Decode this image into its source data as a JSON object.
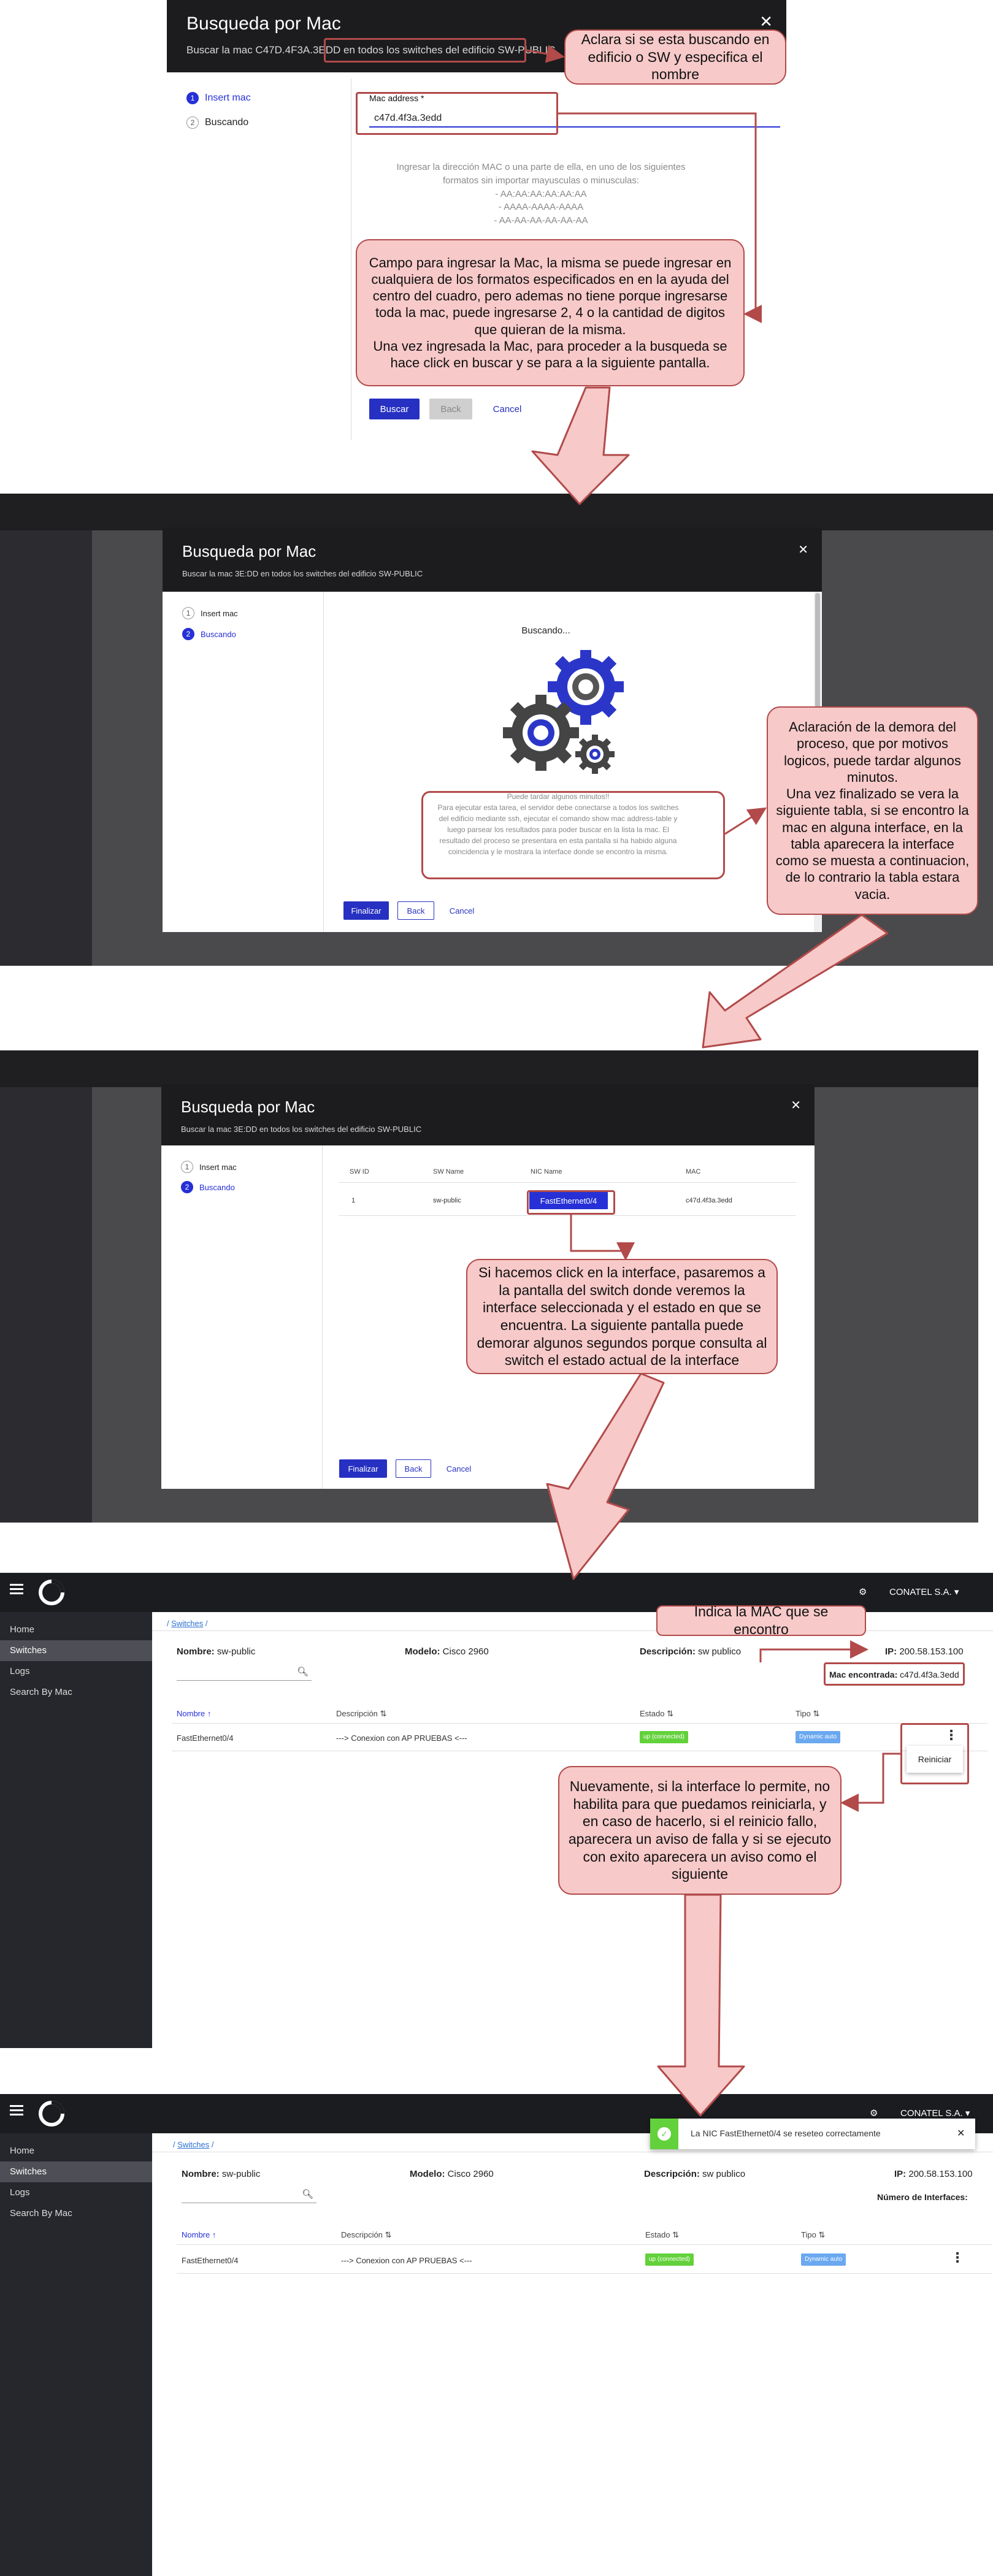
{
  "colors": {
    "accent": "#2630d6",
    "callout_bg": "#f7c9c9",
    "callout_border": "#b24a4a",
    "dark": "#1c1c1e",
    "success": "#63d13b"
  },
  "screen1": {
    "title": "Busqueda por Mac",
    "subtitle": "Buscar la mac C47D.4F3A.3EDD en todos los switches del edificio SW-PUBLIC",
    "steps": [
      "Insert mac",
      "Buscando"
    ],
    "mac_label": "Mac address *",
    "mac_value": "c47d.4f3a.3edd",
    "help_text": "Ingresar la dirección MAC o una parte de ella, en uno de los siguientes\nformatos sin importar mayusculas o minusculas:\n- AA:AA:AA:AA:AA:AA\n- AAAA-AAAA-AAAA\n- AA-AA-AA-AA-AA-AA",
    "buttons": {
      "search": "Buscar",
      "back": "Back",
      "cancel": "Cancel"
    }
  },
  "screen2": {
    "title": "Busqueda por Mac",
    "subtitle": "Buscar la mac 3E:DD en todos los switches del edificio SW-PUBLIC",
    "steps": [
      "Insert mac",
      "Buscando"
    ],
    "status": "Buscando...",
    "info": "Puede tardar algunos minutos!!\nPara ejecutar esta tarea, el servidor debe conectarse a todos los switches\ndel edificio mediante ssh, ejecutar el comando show mac address-table y\nluego parsear los resultados para poder buscar en la lista la mac. El\nresultado del proceso se presentara en esta pantalla si ha habido alguna\ncoincidencia y le mostrara la interface donde se encontro la misma.",
    "buttons": {
      "finish": "Finalizar",
      "back": "Back",
      "cancel": "Cancel"
    }
  },
  "screen3": {
    "title": "Busqueda por Mac",
    "subtitle": "Buscar la mac 3E:DD en todos los switches del edificio SW-PUBLIC",
    "steps": [
      "Insert mac",
      "Buscando"
    ],
    "columns": [
      "SW ID",
      "SW Name",
      "NIC Name",
      "MAC"
    ],
    "row": [
      "1",
      "sw-public",
      "FastEthernet0/4",
      "c47d.4f3a.3edd"
    ],
    "buttons": {
      "finish": "Finalizar",
      "back": "Back",
      "cancel": "Cancel"
    }
  },
  "screen4": {
    "company": "CONATEL S.A.",
    "nav": [
      "Home",
      "Switches",
      "Logs",
      "Search By Mac"
    ],
    "breadcrumb_link": "Switches",
    "name_label": "Nombre:",
    "name_value": "sw-public",
    "model_label": "Modelo:",
    "model_value": "Cisco 2960",
    "desc_label": "Descripción:",
    "desc_value": "sw publico",
    "ip_label": "IP:",
    "ip_value": "200.58.153.100",
    "mac_found_label": "Mac encontrada:",
    "mac_found_value": "c47d.4f3a.3edd",
    "columns": [
      "Nombre",
      "Descripción",
      "Estado",
      "Tipo"
    ],
    "row": {
      "name": "FastEthernet0/4",
      "desc": "---> Conexion con AP PRUEBAS <---",
      "state": "up (connected)",
      "type": "Dynamic auto"
    },
    "menu_item": "Reiniciar"
  },
  "screen5": {
    "company": "CONATEL S.A.",
    "nav": [
      "Home",
      "Switches",
      "Logs",
      "Search By Mac"
    ],
    "breadcrumb_link": "Switches",
    "toast": "La NIC FastEthernet0/4 se reseteo correctamente",
    "name_label": "Nombre:",
    "name_value": "sw-public",
    "model_label": "Modelo:",
    "model_value": "Cisco 2960",
    "desc_label": "Descripción:",
    "desc_value": "sw publico",
    "ip_label": "IP:",
    "ip_value": "200.58.153.100",
    "ifaces_label": "Número de Interfaces:",
    "columns": [
      "Nombre",
      "Descripción",
      "Estado",
      "Tipo"
    ],
    "row": {
      "name": "FastEthernet0/4",
      "desc": "---> Conexion con AP PRUEBAS <---",
      "state": "up (connected)",
      "type": "Dynamic auto"
    }
  },
  "callouts": {
    "c1": "Aclara si se esta buscando en edificio o SW y especifica el nombre",
    "c2": "Campo para ingresar la Mac, la misma se puede ingresar en cualquiera de los formatos especificados en en la ayuda del centro del cuadro, pero ademas no tiene porque ingresarse toda la mac, puede ingresarse 2, 4 o la cantidad de digitos que quieran de la misma.\nUna vez ingresada la Mac, para proceder a la busqueda se hace click en buscar y se para a la siguiente pantalla.",
    "c3": "Aclaración de la demora del proceso, que por motivos logicos, puede tardar algunos minutos.\nUna vez finalizado se vera la siguiente tabla, si se encontro la mac en alguna interface, en la tabla aparecera la interface como se muesta a continuacion, de lo contrario la tabla estara vacia.",
    "c4": "Si hacemos click en la interface, pasaremos a la pantalla del switch donde veremos la interface seleccionada y el estado en que se encuentra. La siguiente pantalla puede demorar algunos segundos porque consulta al switch el estado actual de la interface",
    "c5": "Indica la MAC que se encontro",
    "c6": "Nuevamente, si la interface lo permite, no habilita para que puedamos reiniciarla, y en caso de hacerlo, si el reinicio fallo, aparecera un aviso de falla y si se ejecuto con exito aparecera un aviso como el siguiente"
  }
}
